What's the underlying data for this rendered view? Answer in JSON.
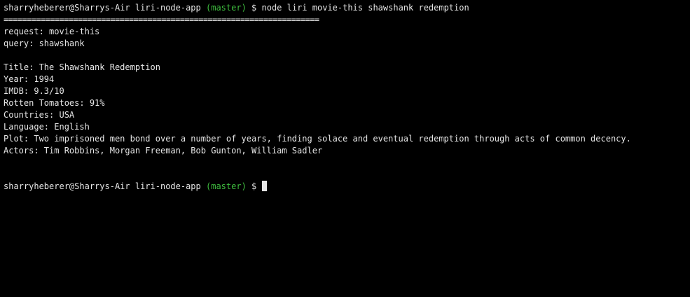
{
  "terminal": {
    "prompt": {
      "user_host_dir": "sharryheberer@Sharrys-Air liri-node-app",
      "branch": "(master)",
      "symbol": "$"
    },
    "command": "node liri movie-this shawshank redemption",
    "separator": "====================================================================",
    "output": [
      "request: movie-this",
      "query: shawshank",
      "",
      "Title: The Shawshank Redemption",
      "Year: 1994",
      "IMDB: 9.3/10",
      "Rotten Tomatoes: 91%",
      "Countries: USA",
      "Language: English",
      "Plot: Two imprisoned men bond over a number of years, finding solace and eventual redemption through acts of common decency.",
      "Actors: Tim Robbins, Morgan Freeman, Bob Gunton, William Sadler"
    ]
  },
  "colors": {
    "background": "#000000",
    "text": "#e6e6e6",
    "branch": "#3fbf3f"
  }
}
